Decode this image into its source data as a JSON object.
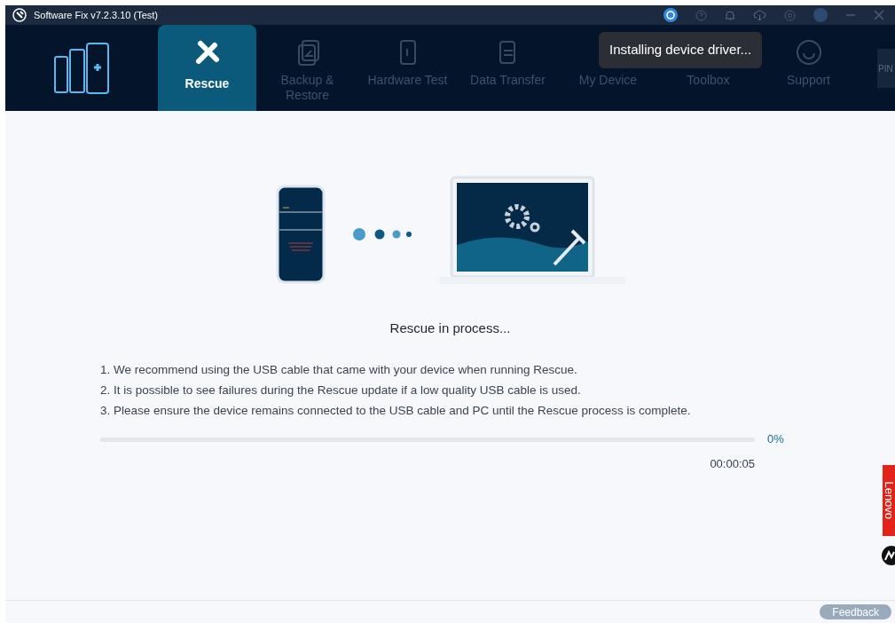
{
  "window": {
    "title": "Software Fix v7.2.3.10 (Test)"
  },
  "tabs": [
    {
      "label": "Rescue",
      "selected": true
    },
    {
      "label": "Backup &\nRestore",
      "selected": false
    },
    {
      "label": "Hardware Test",
      "selected": false
    },
    {
      "label": "Data Transfer",
      "selected": false
    },
    {
      "label": "My Device",
      "selected": false
    },
    {
      "label": "Toolbox",
      "selected": false
    },
    {
      "label": "Support",
      "selected": false
    }
  ],
  "tooltip": "Installing device driver...",
  "pin_button": "PIN",
  "status": "Rescue in process...",
  "notes": [
    "1. We recommend using the USB cable that came with your device when running Rescue.",
    "2. It is possible to see failures during the Rescue update if a low quality USB cable is used.",
    "3. Please ensure the device remains connected to the USB cable and PC until the Rescue process is complete."
  ],
  "progress": {
    "level": 0,
    "percent": "0%",
    "elapsed": "00:00:05"
  },
  "side_tab": "Lenovo",
  "feedback": "Feedback"
}
